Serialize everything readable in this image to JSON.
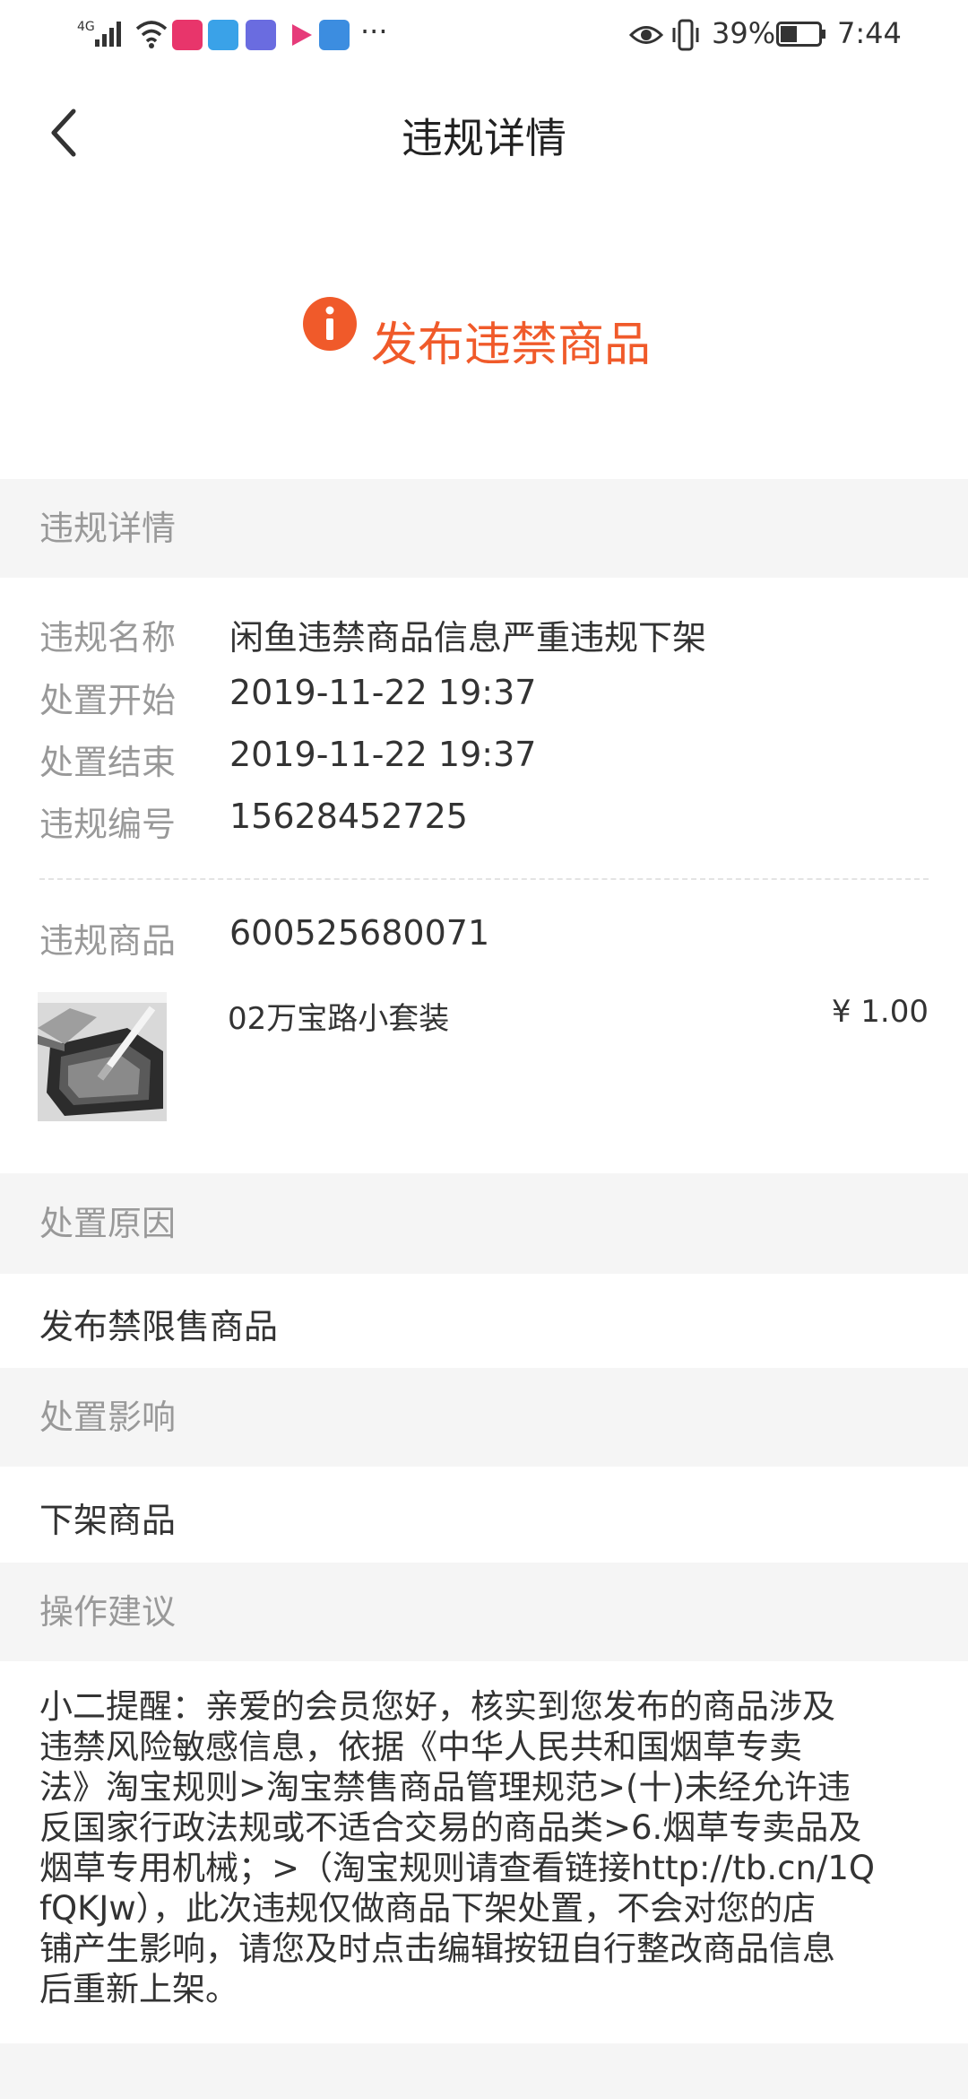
{
  "status_bar": {
    "network": "4G",
    "battery": "39%",
    "time": "7:44",
    "more": "···"
  },
  "nav": {
    "title": "违规详情"
  },
  "hero": {
    "title": "发布违禁商品",
    "accent_color": "#f05a2a"
  },
  "details_section": {
    "header": "违规详情",
    "rows": [
      {
        "label": "违规名称",
        "value": "闲鱼违禁商品信息严重违规下架"
      },
      {
        "label": "处置开始",
        "value": "2019-11-22 19:37"
      },
      {
        "label": "处置结束",
        "value": "2019-11-22 19:37"
      },
      {
        "label": "违规编号",
        "value": "15628452725"
      }
    ]
  },
  "product": {
    "label": "违规商品",
    "id": "600525680071",
    "name": "02万宝路小套装",
    "price": "¥  1.00"
  },
  "reason": {
    "header": "处置原因",
    "text": "发布禁限售商品"
  },
  "impact": {
    "header": "处置影响",
    "text": "下架商品"
  },
  "advice": {
    "header": "操作建议",
    "lines": [
      "小二提醒：亲爱的会员您好，核实到您发布的商品涉及",
      "违禁风险敏感信息，依据《中华人民共和国烟草专卖",
      "法》淘宝规则>淘宝禁售商品管理规范>(十)未经允许违",
      "反国家行政法规或不适合交易的商品类>6.烟草专卖品及",
      "烟草专用机械；>（淘宝规则请查看链接http://tb.cn/1Q",
      "fQKJw），此次违规仅做商品下架处置，不会对您的店",
      "铺产生影响，请您及时点击编辑按钮自行整改商品信息",
      "后重新上架。"
    ]
  },
  "icons": {
    "back": "back-icon",
    "hero": "info-icon",
    "signal": "signal-icon",
    "wifi": "wifi-icon",
    "eye": "eye-icon",
    "vibrate": "vibrate-icon",
    "battery": "battery-icon"
  }
}
